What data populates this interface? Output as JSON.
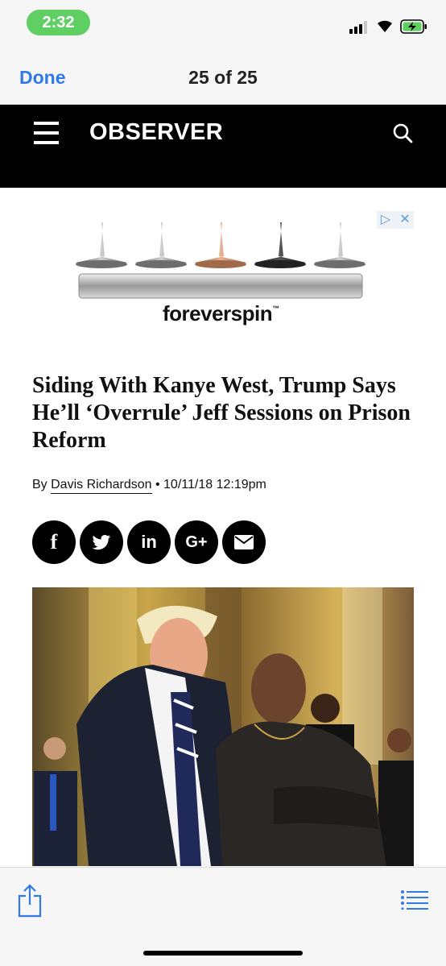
{
  "status_bar": {
    "time": "2:32",
    "signal_bars_active": 3,
    "signal_bars_total": 4,
    "battery_charging": true,
    "accent_color": "#5fcf63"
  },
  "nav": {
    "done_label": "Done",
    "page_counter": "25 of 25"
  },
  "site": {
    "logo_text": "OBSERVER",
    "menu_icon": "hamburger-icon",
    "search_icon": "search-icon"
  },
  "ad": {
    "brand": "foreverspin",
    "trademark": "™",
    "adchoices_icons": [
      "adchoices-icon",
      "close-icon"
    ]
  },
  "article": {
    "headline": "Siding With Kanye West, Trump Says He’ll ‘Overrule’ Jeff Sessions on Prison Reform",
    "byline_prefix": "By",
    "author": "Davis Richardson",
    "separator": "•",
    "datetime": "10/11/18 12:19pm",
    "share_buttons": [
      {
        "name": "facebook",
        "label": "f"
      },
      {
        "name": "twitter",
        "label": "t"
      },
      {
        "name": "linkedin",
        "label": "in"
      },
      {
        "name": "google-plus",
        "label": "G+"
      },
      {
        "name": "email",
        "label": "✉"
      }
    ]
  },
  "toolbar": {
    "share_icon": "share-icon",
    "list_icon": "list-icon",
    "accent_color": "#2f7ae5"
  }
}
